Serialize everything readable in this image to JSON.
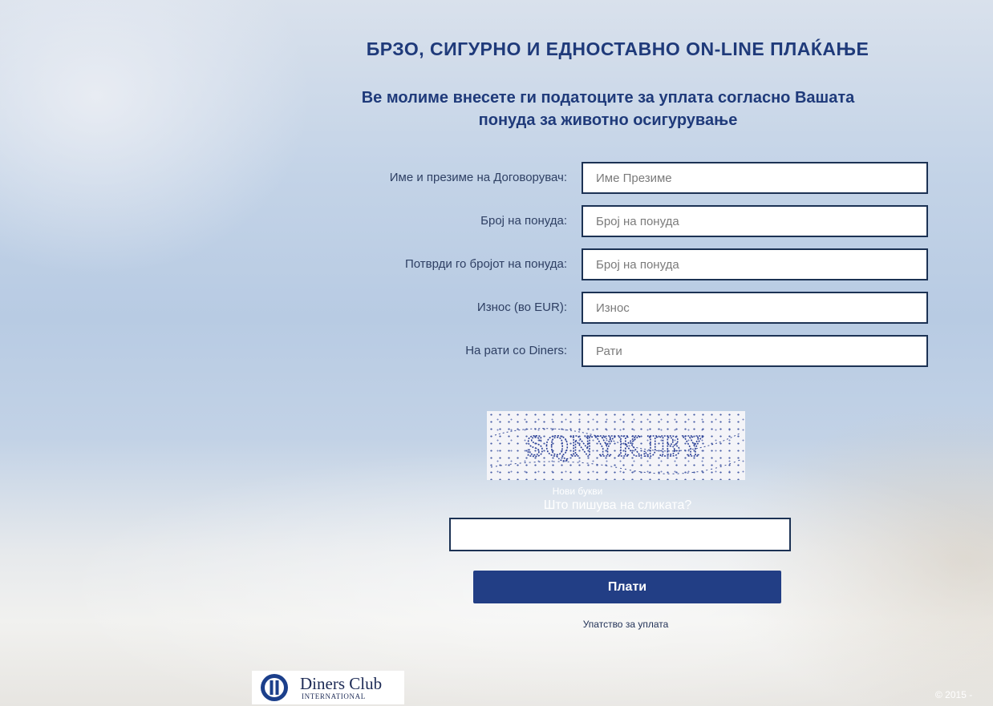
{
  "header": {
    "title": "БРЗО, СИГУРНО И ЕДНОСТАВНО ON-LINE ПЛАЌАЊЕ",
    "subtitle_line1": "Ве молиме внесете ги податоците за уплата согласно Вашата",
    "subtitle_line2": "понуда за животно осигурување"
  },
  "form": {
    "fields": [
      {
        "label": "Име и презиме на Договорувач:",
        "placeholder": "Име Презиме",
        "value": ""
      },
      {
        "label": "Број на понуда:",
        "placeholder": "Број на понуда",
        "value": ""
      },
      {
        "label": "Потврди го бројот на понуда:",
        "placeholder": "Број на понуда",
        "value": ""
      },
      {
        "label": "Износ (во EUR):",
        "placeholder": "Износ",
        "value": ""
      },
      {
        "label": "На рати со Diners:",
        "placeholder": "Рати",
        "value": ""
      }
    ]
  },
  "captcha": {
    "text": "SQNYKJBY",
    "new_letters": "Нови букви",
    "question": "Што пишува на сликата?",
    "answer": ""
  },
  "pay_button": "Плати",
  "instructions_link": "Упатство за уплата",
  "footer": {
    "logo_brand": "Diners Club",
    "logo_sub": "INTERNATIONAL",
    "copyright": "© 2015 -"
  },
  "colors": {
    "accent": "#223e85",
    "heading": "#1f3a7a",
    "input_border": "#1c3254"
  }
}
